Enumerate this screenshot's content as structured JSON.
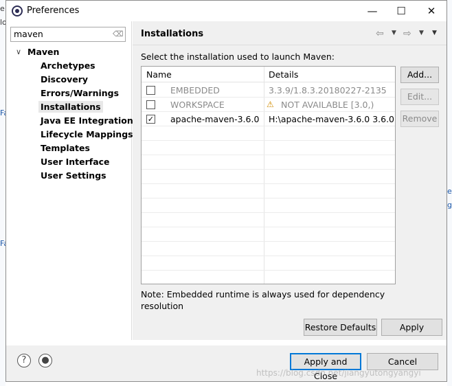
{
  "window": {
    "title": "Preferences",
    "minimize": "—",
    "maximize": "☐",
    "close": "✕"
  },
  "filter": {
    "value": "maven"
  },
  "tree": {
    "root": "Maven",
    "children": [
      "Archetypes",
      "Discovery",
      "Errors/Warnings",
      "Installations",
      "Java EE Integration",
      "Lifecycle Mappings",
      "Templates",
      "User Interface",
      "User Settings"
    ],
    "selected": "Installations"
  },
  "page": {
    "title": "Installations",
    "prompt": "Select the installation used to launch Maven:",
    "columns": [
      "Name",
      "Details"
    ],
    "rows": [
      {
        "checked": false,
        "name": "EMBEDDED",
        "details": "3.3.9/1.8.3.20180227-2135",
        "dim": true,
        "warn": false
      },
      {
        "checked": false,
        "name": "WORKSPACE",
        "details": "NOT AVAILABLE [3.0,)",
        "dim": true,
        "warn": true
      },
      {
        "checked": true,
        "name": "apache-maven-3.6.0",
        "details": "H:\\apache-maven-3.6.0 3.6.0",
        "dim": false,
        "warn": false
      }
    ],
    "buttons": {
      "add": "Add...",
      "edit": "Edit...",
      "remove": "Remove"
    },
    "note": "Note: Embedded runtime is always used for dependency resolution",
    "restore_defaults": "Restore Defaults",
    "apply": "Apply"
  },
  "footer": {
    "apply_and_close": "Apply and Close",
    "cancel": "Cancel",
    "help": "?"
  },
  "watermark": "https://blog.csdn.net/jiangyutongyangyi",
  "background_fragments": [
    "e",
    "lo",
    "Fa",
    "Fa",
    "e",
    "g",
    "o"
  ],
  "colors": {
    "accent": "#0078d7",
    "warning": "#d08b00",
    "selection": "#e8e8e8"
  }
}
